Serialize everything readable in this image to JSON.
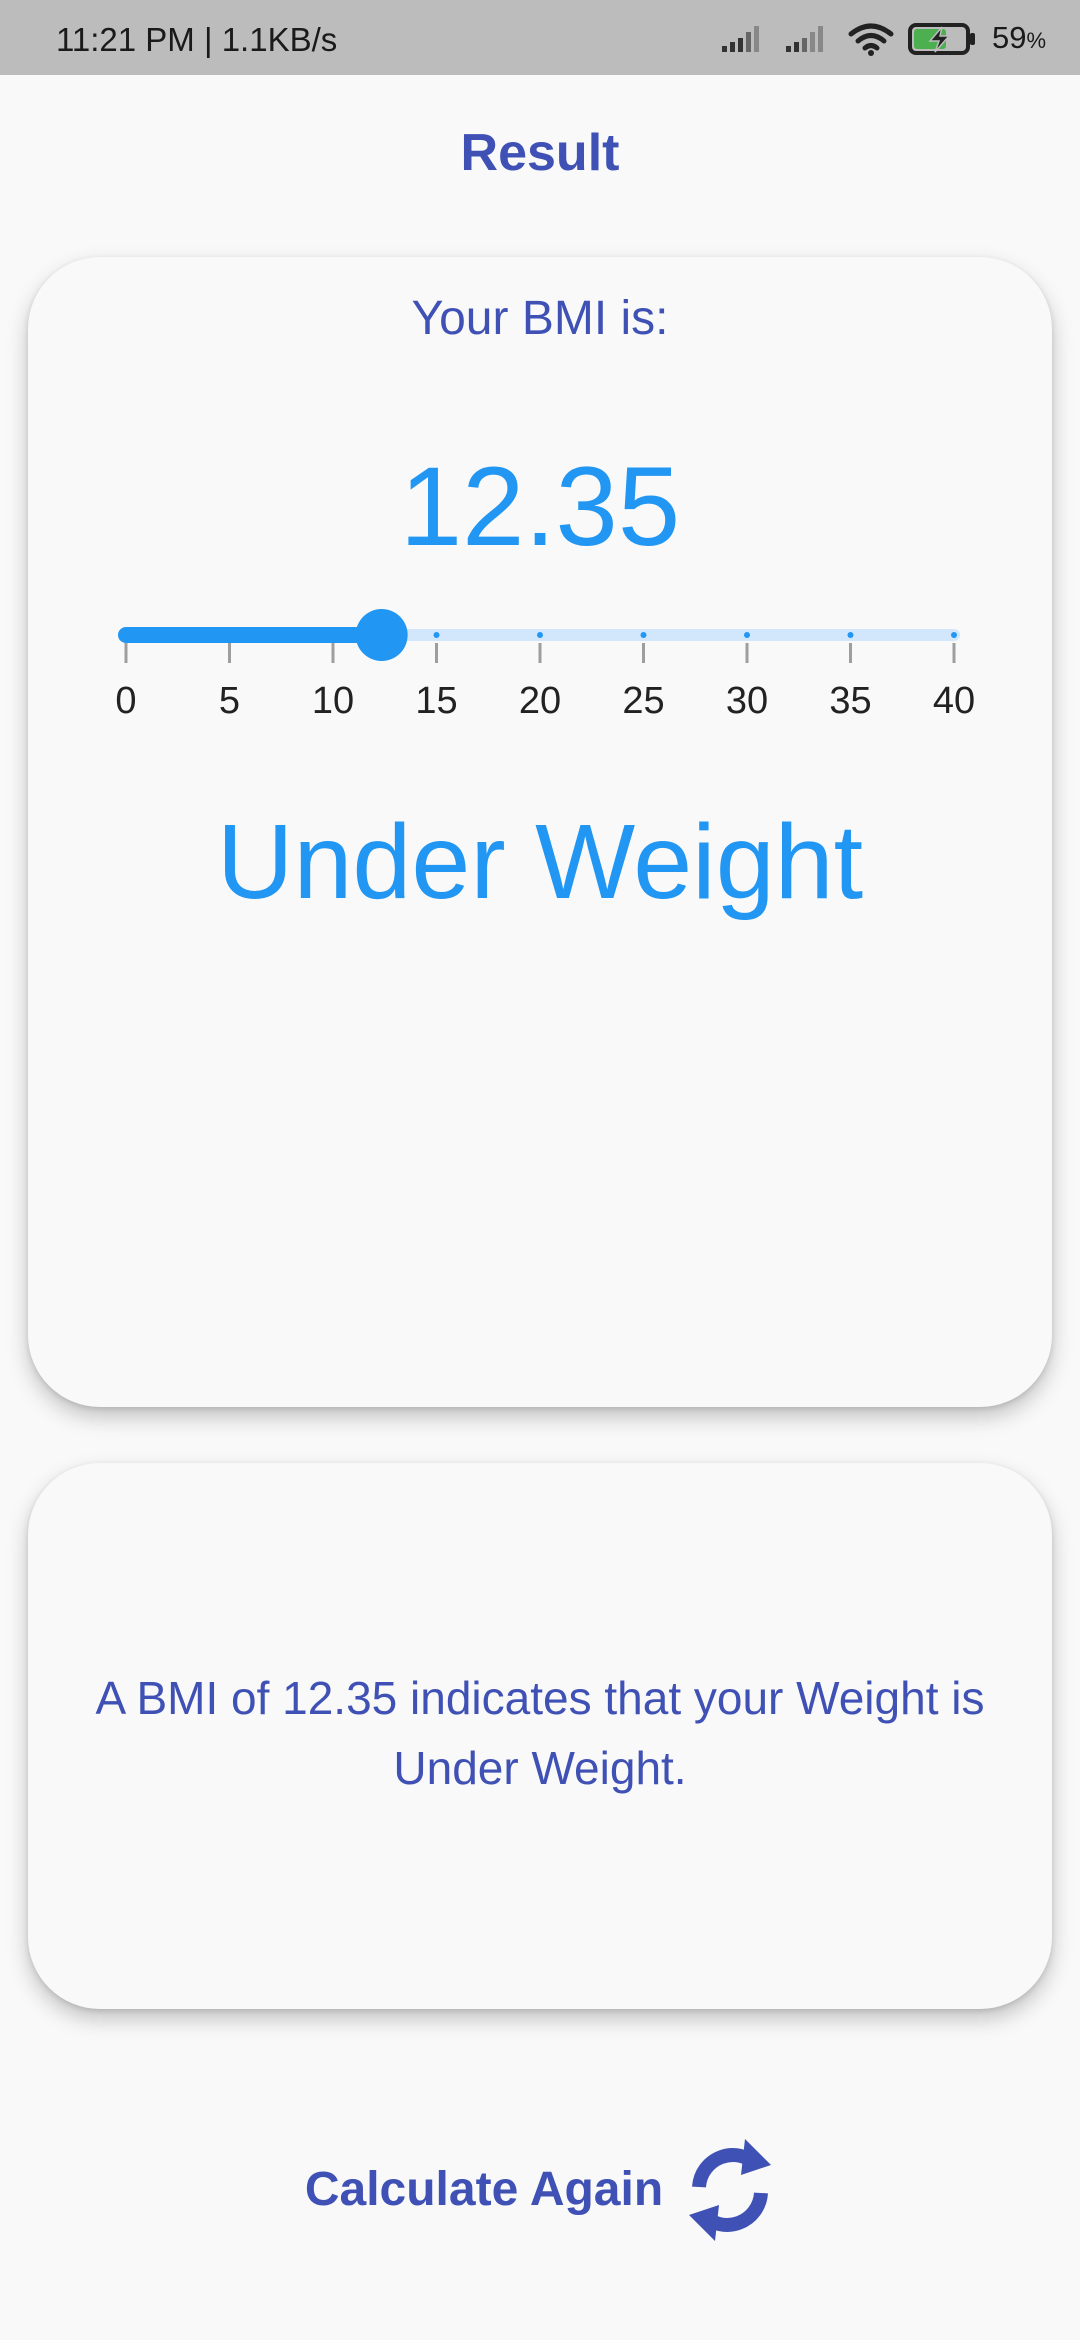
{
  "status_bar": {
    "time_speed": "11:21 PM | 1.1KB/s",
    "battery_percent": "59",
    "battery_percent_sign": "%",
    "icons": [
      "signal-icon",
      "signal-icon",
      "wifi-icon",
      "battery-charging-icon"
    ]
  },
  "header": {
    "title": "Result"
  },
  "result_card": {
    "heading": "Your BMI is:",
    "bmi_value": "12.35",
    "slider": {
      "min": 0,
      "max": 40,
      "value": 12.35,
      "tick_labels": [
        "0",
        "5",
        "10",
        "15",
        "20",
        "25",
        "30",
        "35",
        "40"
      ]
    },
    "category": "Under Weight"
  },
  "description_card": {
    "text": "A BMI of 12.35 indicates that your Weight is Under Weight."
  },
  "actions": {
    "calculate_again_label": "Calculate Again",
    "calculate_again_icon": "refresh-icon"
  },
  "colors": {
    "primary": "#3f51b5",
    "accent": "#2196f3",
    "accent_light": "#d2e7fb",
    "background": "#f9f9f9",
    "status_bar": "#bcbcbc"
  }
}
